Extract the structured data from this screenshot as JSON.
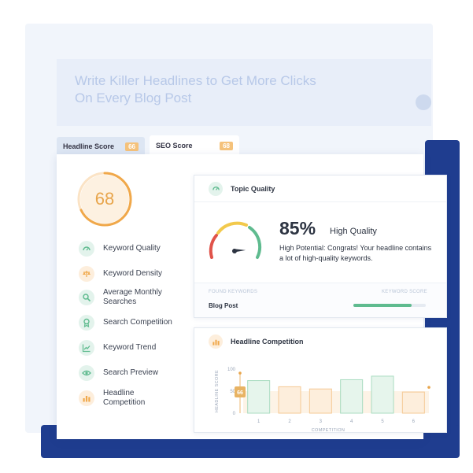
{
  "hero": {
    "line1": "Write Killer Headlines to Get More Clicks",
    "line2": "On Every Blog Post"
  },
  "tabs": [
    {
      "label": "Headline Score",
      "badge": "66",
      "active": false
    },
    {
      "label": "SEO Score",
      "badge": "68",
      "active": true
    }
  ],
  "score": {
    "value": "68",
    "fraction": 0.68
  },
  "sidebar": {
    "items": [
      {
        "label": "Keyword Quality",
        "icon": "gauge-icon",
        "tone": "green"
      },
      {
        "label": "Keyword Density",
        "icon": "scale-icon",
        "tone": "orange"
      },
      {
        "label": "Average Monthly Searches",
        "icon": "search-icon",
        "tone": "green"
      },
      {
        "label": "Search Competition",
        "icon": "ribbon-icon",
        "tone": "green"
      },
      {
        "label": "Keyword Trend",
        "icon": "trend-chart-icon",
        "tone": "green"
      },
      {
        "label": "Search Preview",
        "icon": "eye-icon",
        "tone": "green"
      },
      {
        "label": "Headline Competition",
        "icon": "bar-chart-icon",
        "tone": "orange"
      }
    ]
  },
  "topic": {
    "title": "Topic Quality",
    "percent": "85%",
    "quality": "High Quality",
    "description": "High Potential: Congrats! Your headline contains a lot of high-quality keywords.",
    "gauge_fraction": 0.85,
    "keywords_header": "FOUND KEYWORDS",
    "score_header": "KEYWORD SCORE",
    "keywords": [
      {
        "name": "Blog Post",
        "score_fraction": 0.8
      }
    ]
  },
  "competition": {
    "title": "Headline Competition",
    "marker_label": "66"
  },
  "colors": {
    "green": "#5fbb8f",
    "orange": "#f0a84a",
    "navy": "#1f3d8f",
    "red": "#e0534a",
    "yellow": "#f2c94c"
  },
  "chart_data": {
    "type": "bar",
    "categories": [
      "1",
      "2",
      "3",
      "4",
      "5",
      "6"
    ],
    "values": [
      74,
      60,
      55,
      76,
      84,
      48
    ],
    "colors": [
      "green",
      "orange",
      "orange",
      "green",
      "green",
      "orange"
    ],
    "ylabel": "HEADLINE SCORE",
    "xlabel": "COMPETITION",
    "yticks": [
      "0",
      "50",
      "100"
    ],
    "ylim": [
      0,
      100
    ],
    "marker": {
      "label": "66",
      "value": 66
    }
  }
}
